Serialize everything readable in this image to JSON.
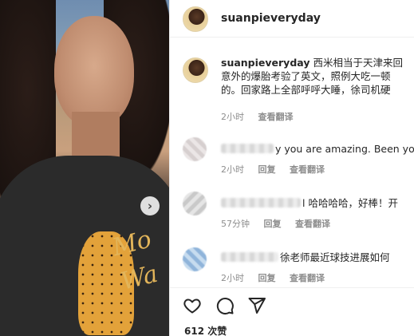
{
  "header": {
    "username": "suanpieveryday"
  },
  "caption": {
    "username": "suanpieveryday",
    "line1": "西米相当于天津来回",
    "line2": "意外的爆胎考验了英文，照例大吃一顿",
    "line3": "的。回家路上全部呼呼大睡，徐司机硬",
    "time": "2小时",
    "translate": "查看翻译"
  },
  "comments": [
    {
      "text": "y you are amazing. Been yo",
      "time": "2小时",
      "reply": "回复",
      "translate": "查看翻译"
    },
    {
      "text": "l 哈哈哈哈，好棒！开",
      "time": "57分钟",
      "reply": "回复",
      "translate": "查看翻译"
    },
    {
      "text": "徐老师最近球技进展如何",
      "time": "2小时",
      "reply": "回复",
      "translate": "查看翻译"
    }
  ],
  "actions": {
    "like_icon": "heart-icon",
    "comment_icon": "comment-icon",
    "share_icon": "send-icon"
  },
  "likes": "612 次赞",
  "colors": {
    "text": "#262626",
    "muted": "#8e8e8e",
    "divider": "#efefef"
  }
}
